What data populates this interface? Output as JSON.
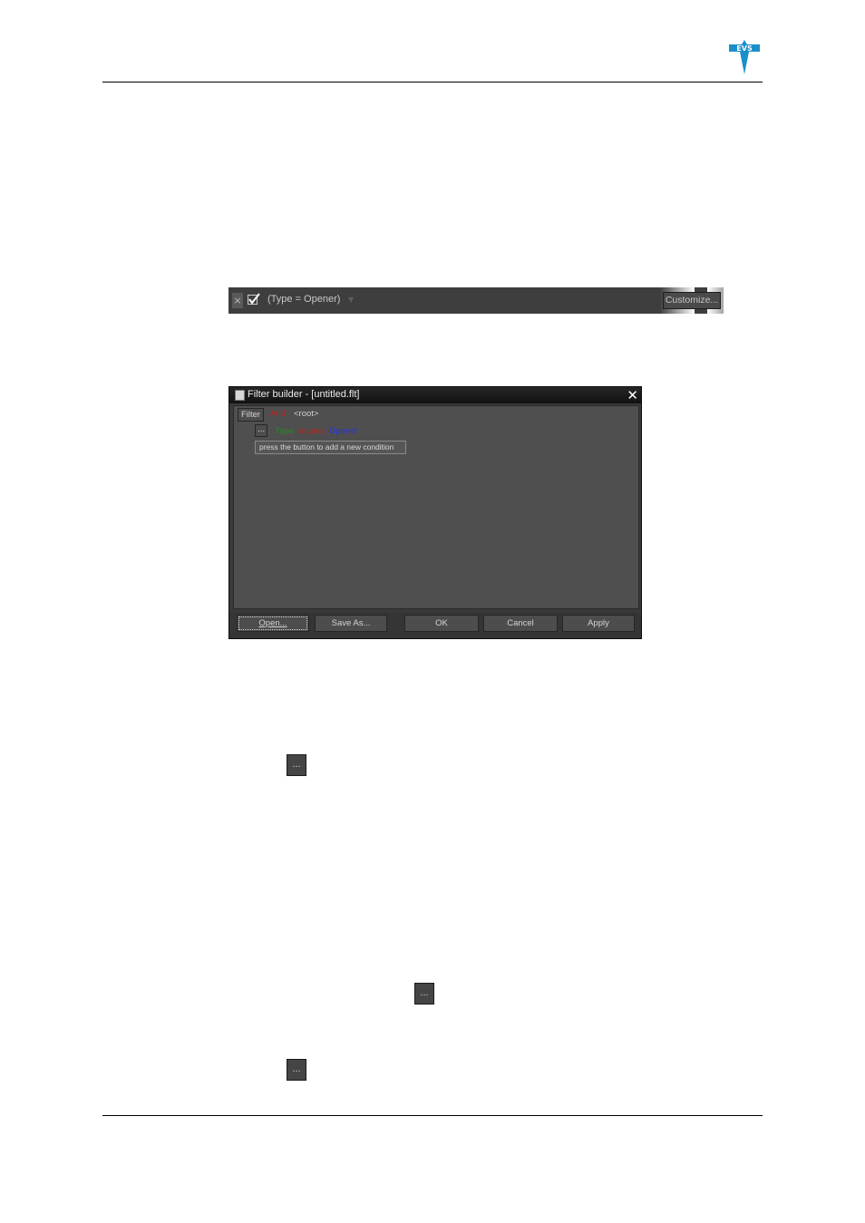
{
  "brand": {
    "logo_text": "EVS",
    "color": "#1a8fc9"
  },
  "filter_bar": {
    "close_glyph": "×",
    "filter_text": "(Type = Opener)",
    "customize_label": "Customize..."
  },
  "dialog": {
    "title": "Filter builder - [untitled.flt]",
    "close_glyph": "✕",
    "filter_button": "Filter",
    "root_operator": "And",
    "root_label": "<root>",
    "condition": {
      "ellipsis": "...",
      "field": "Type",
      "operator": "equals",
      "value": "Opener"
    },
    "hint": "press the button to add a new condition",
    "buttons": {
      "open": "Open...",
      "save_as": "Save As...",
      "ok": "OK",
      "cancel": "Cancel",
      "apply": "Apply"
    }
  },
  "inline_buttons": {
    "ellipsis": "..."
  }
}
